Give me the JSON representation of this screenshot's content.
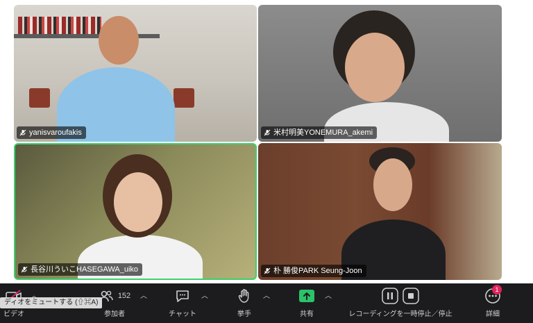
{
  "participants": [
    {
      "name": "yanisvaroufakis"
    },
    {
      "name": "米村明美YONEMURA_akemi"
    },
    {
      "name": "長谷川ういこHASEGAWA_uiko"
    },
    {
      "name": "朴 勝俊PARK Seung-Joon"
    }
  ],
  "toolbar": {
    "video_label": "ビデオ",
    "participants_label": "参加者",
    "participants_count": "152",
    "chat_label": "チャット",
    "raise_hand_label": "挙手",
    "share_label": "共有",
    "recording_label": "レコーディングを一時停止／停止",
    "more_label": "詳細",
    "more_badge": "1",
    "mute_tooltip": "ディオをミュートする (⇧⌘A)"
  },
  "colors": {
    "active_speaker": "#3bd16f",
    "share_green": "#2bc26a",
    "badge_red": "#e0245e",
    "toolbar_bg": "#1c1c1e"
  }
}
